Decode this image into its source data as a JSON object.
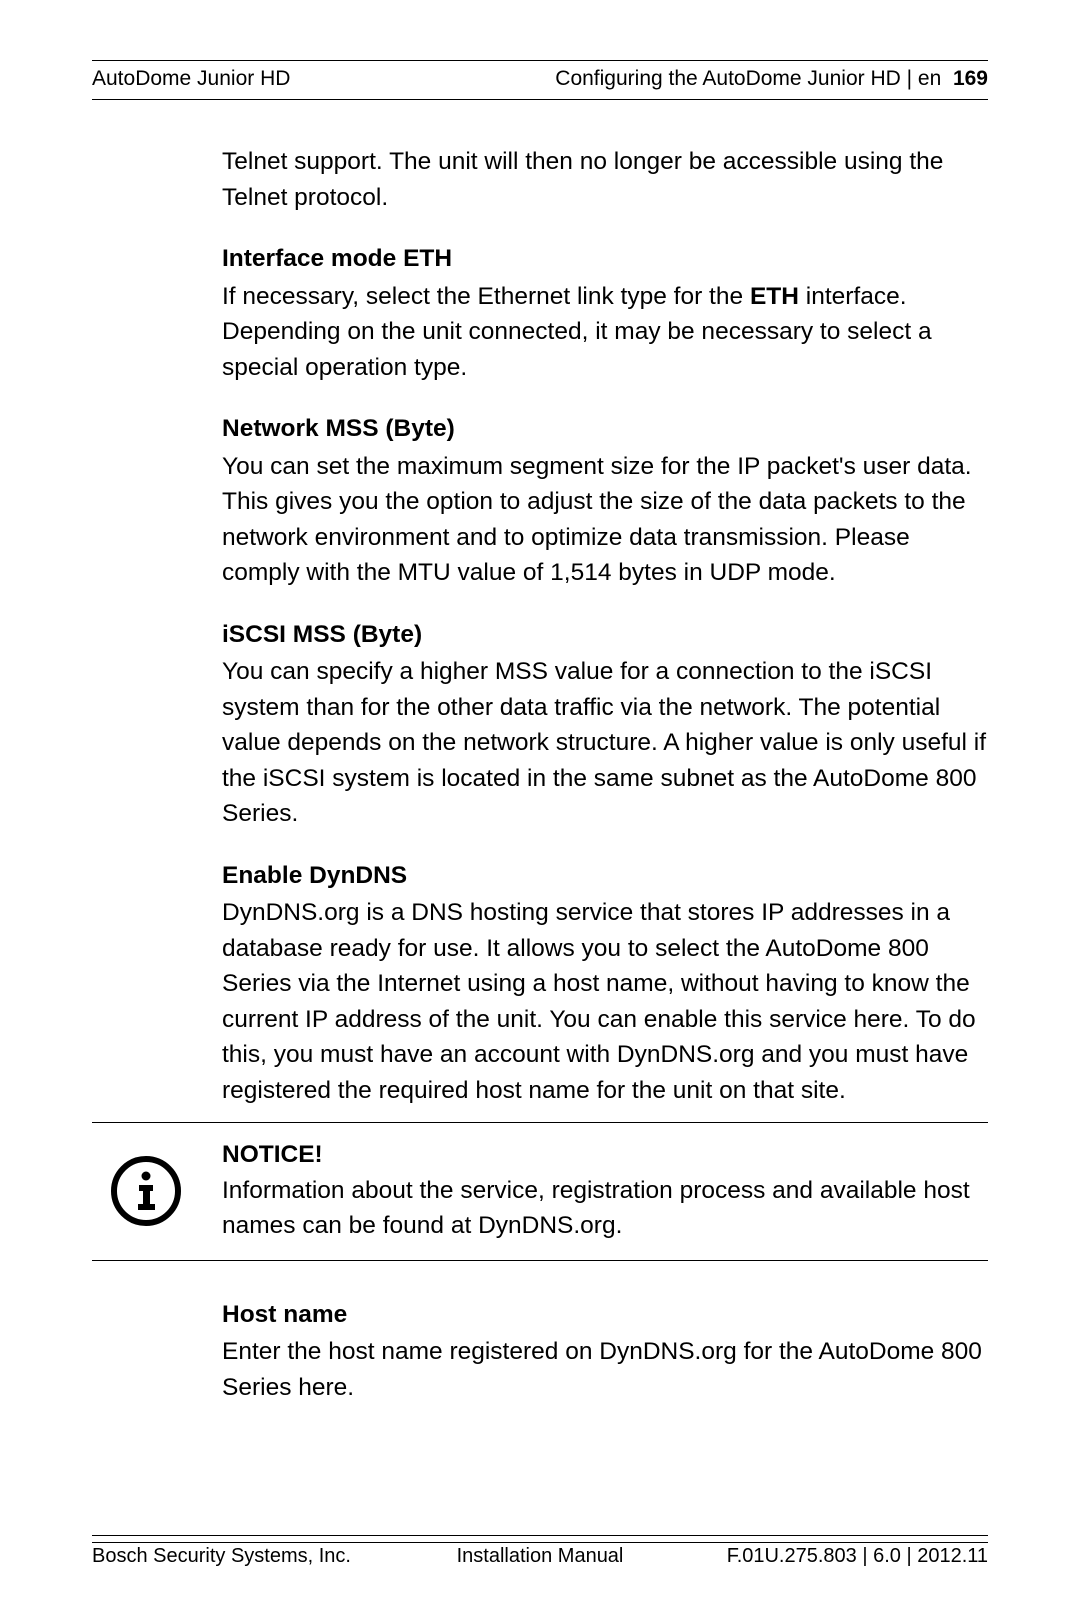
{
  "header": {
    "left": "AutoDome Junior HD",
    "right_prefix": "Configuring the AutoDome Junior HD | en",
    "page": "169"
  },
  "body": {
    "telnet_para": "Telnet support. The unit will then no longer be accessible using the Telnet protocol.",
    "interface_mode_title": "Interface mode ETH",
    "interface_mode_text_a": "If necessary, select the Ethernet link type for the ",
    "interface_mode_bold": "ETH",
    "interface_mode_text_b": " interface. Depending on the unit connected, it may be necessary to select a special operation type.",
    "network_mss_title": "Network MSS (Byte)",
    "network_mss_text": "You can set the maximum segment size for the IP packet's user data. This gives you the option to adjust the size of the data packets to the network environment and to optimize data transmission. Please comply with the MTU value of 1,514 bytes in UDP mode.",
    "iscsi_mss_title": "iSCSI MSS (Byte)",
    "iscsi_mss_text": "You can specify a higher MSS value for a connection to the iSCSI system than for the other data traffic via the network. The potential value depends on the network structure. A higher value is only useful if the iSCSI system is located in the same subnet as the AutoDome 800 Series.",
    "dyndns_title": "Enable DynDNS",
    "dyndns_text": "DynDNS.org is a DNS hosting service that stores IP addresses in a database ready for use. It allows you to select the AutoDome 800 Series via the Internet using a host name, without having to know the current IP address of the unit. You can enable this service here. To do this, you must have an account with DynDNS.org and you must have registered the required host name for the unit on that site.",
    "notice_title": "NOTICE!",
    "notice_text": "Information about the service, registration process and available host names can be found at DynDNS.org.",
    "hostname_title": "Host name",
    "hostname_text": "Enter the host name registered on DynDNS.org for the AutoDome 800 Series here."
  },
  "footer": {
    "left": "Bosch Security Systems, Inc.",
    "center": "Installation Manual",
    "right": "F.01U.275.803 | 6.0 | 2012.11"
  }
}
